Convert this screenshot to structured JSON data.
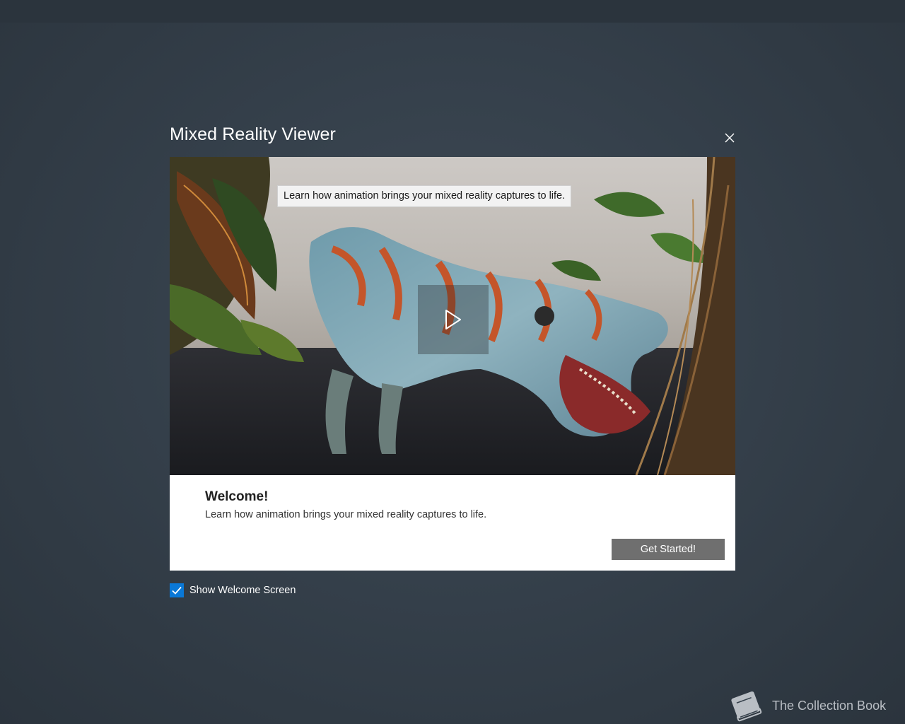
{
  "window": {
    "title": "Mixed Reality Viewer"
  },
  "video": {
    "tooltip": "Learn how animation brings your mixed reality captures to life.",
    "play_icon": "play-icon"
  },
  "welcome": {
    "heading": "Welcome!",
    "body": "Learn how animation brings your mixed reality captures to life.",
    "button_label": "Get Started!"
  },
  "settings": {
    "show_welcome_label": "Show Welcome Screen",
    "show_welcome_checked": true
  },
  "watermark": {
    "text": "The Collection Book"
  },
  "colors": {
    "background": "#35404b",
    "accent": "#0a78d7",
    "button": "#6f6f6f"
  }
}
